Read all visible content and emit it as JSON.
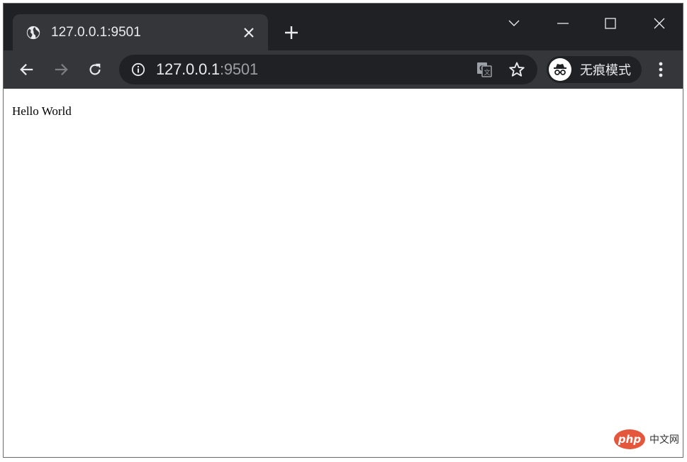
{
  "tab": {
    "title": "127.0.0.1:9501",
    "icon": "globe-icon"
  },
  "address_bar": {
    "host": "127.0.0.1",
    "port": ":9501"
  },
  "profile": {
    "label": "无痕模式",
    "icon": "incognito-icon"
  },
  "page": {
    "body_text": "Hello World"
  },
  "watermark": {
    "logo": "php",
    "text": "中文网"
  },
  "colors": {
    "tabstrip_bg": "#202124",
    "toolbar_bg": "#35363a",
    "omnibox_bg": "#202124",
    "text_primary": "#e8eaed",
    "text_secondary": "#9aa0a6",
    "watermark_brand": "#e4573d"
  }
}
